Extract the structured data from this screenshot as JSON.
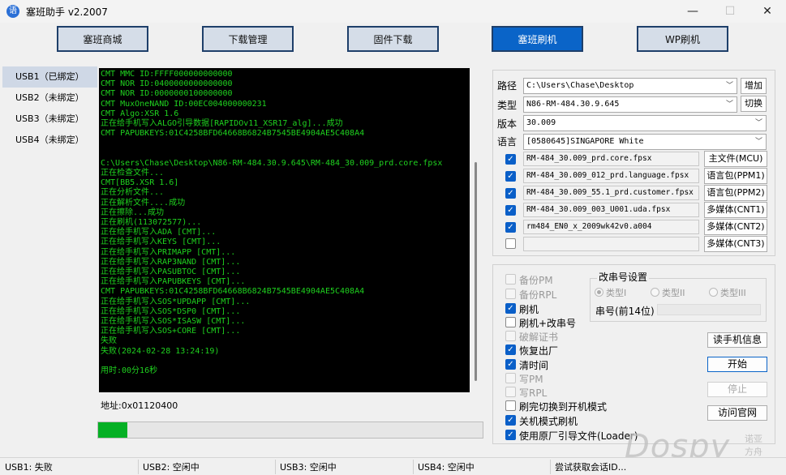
{
  "window": {
    "title": "塞班助手 v2.2007",
    "icon_glyph": "语",
    "minimize": "—",
    "maximize": "☐",
    "close": "✕"
  },
  "nav": {
    "buttons": [
      "塞班商城",
      "下载管理",
      "固件下载",
      "塞班刷机",
      "WP刷机"
    ],
    "active": "塞班刷机"
  },
  "usb_list": [
    "USB1（已绑定）",
    "USB2（未绑定）",
    "USB3（未绑定）",
    "USB4（未绑定）"
  ],
  "console_lines": [
    "CMT MMC ID:FFFF000000000000",
    "CMT NOR ID:0400000000000000",
    "CMT NOR ID:0000000100000000",
    "CMT MuxOneNAND ID:00EC004000000231",
    "CMT Algo:XSR 1.6",
    "正在给手机写入ALGO引导数据[RAPIDOv11_XSR17_alg]...成功",
    "CMT PAPUBKEYS:01C4258BFD64668B6824B7545BE4904AE5C408A4",
    "",
    "",
    "C:\\Users\\Chase\\Desktop\\N86-RM-484.30.9.645\\RM-484_30.009_prd.core.fpsx",
    "正在检查文件...",
    "CMT[BB5.XSR 1.6]",
    "正在分析文件...",
    "正在解析文件....成功",
    "正在擦除...成功",
    "正在刷机(113072577)...",
    "正在给手机写入ADA [CMT]...",
    "正在给手机写入KEYS [CMT]...",
    "正在给手机写入PRIMAPP [CMT]...",
    "正在给手机写入RAP3NAND [CMT]...",
    "正在给手机写入PASUBTOC [CMT]...",
    "正在给手机写入PAPUBKEYS [CMT]...",
    "CMT PAPUBKEYS:01C4258BFD64668B6824B7545BE4904AE5C408A4",
    "正在给手机写入SOS*UPDAPP [CMT]...",
    "正在给手机写入SOS*DSP0 [CMT]...",
    "正在给手机写入SOS*ISASW [CMT]...",
    "正在给手机写入SOS+CORE [CMT]...",
    "失败",
    "失败(2024-02-28 13:24:19)",
    "",
    "用时:00分16秒"
  ],
  "address": "地址:0x01120400",
  "progress_fraction": 0.075,
  "settings": {
    "path_label": "路径",
    "path_value": "C:\\Users\\Chase\\Desktop",
    "add_button": "增加",
    "type_label": "类型",
    "type_value": "N86-RM-484.30.9.645",
    "switch_button": "切换",
    "version_label": "版本",
    "version_value": "30.009",
    "language_label": "语言",
    "language_value": "[0580645]SINGAPORE White"
  },
  "files": [
    {
      "checked": true,
      "name": "RM-484_30.009_prd.core.fpsx",
      "button": "主文件(MCU)"
    },
    {
      "checked": true,
      "name": "RM-484_30.009_012_prd.language.fpsx",
      "button": "语言包(PPM1)"
    },
    {
      "checked": true,
      "name": "RM-484_30.009_55.1_prd.customer.fpsx",
      "button": "语言包(PPM2)"
    },
    {
      "checked": true,
      "name": "RM-484_30.009_003_U001.uda.fpsx",
      "button": "多媒体(CNT1)"
    },
    {
      "checked": true,
      "name": "rm484_EN0_x_2009wk42v0.a004",
      "button": "多媒体(CNT2)"
    },
    {
      "checked": false,
      "name": "",
      "button": "多媒体(CNT3)"
    }
  ],
  "options": [
    {
      "label": "备份PM",
      "checked": false,
      "enabled": false
    },
    {
      "label": "备份RPL",
      "checked": false,
      "enabled": false
    },
    {
      "label": "刷机",
      "checked": true,
      "enabled": true
    },
    {
      "label": "刷机+改串号",
      "checked": false,
      "enabled": true
    },
    {
      "label": "破解证书",
      "checked": false,
      "enabled": false
    },
    {
      "label": "恢复出厂",
      "checked": true,
      "enabled": true
    },
    {
      "label": "清时间",
      "checked": true,
      "enabled": true
    },
    {
      "label": "写PM",
      "checked": false,
      "enabled": false
    },
    {
      "label": "写RPL",
      "checked": false,
      "enabled": false
    },
    {
      "label": "刷完切换到开机模式",
      "checked": false,
      "enabled": true
    },
    {
      "label": "关机模式刷机",
      "checked": true,
      "enabled": true
    },
    {
      "label": "使用原厂引导文件(Loader)",
      "checked": true,
      "enabled": true
    }
  ],
  "serial_group": {
    "title": "改串号设置",
    "types": [
      "类型I",
      "类型II",
      "类型III"
    ],
    "serial_label": "串号(前14位)"
  },
  "actions": {
    "read_info": "读手机信息",
    "start": "开始",
    "stop": "停止",
    "website": "访问官网"
  },
  "statusbar": [
    "USB1: 失败",
    "USB2: 空闲中",
    "USB3: 空闲中",
    "USB4: 空闲中",
    "尝试获取会话ID..."
  ],
  "watermark": {
    "text": "Dospy",
    "cn": "诺亚方舟"
  }
}
